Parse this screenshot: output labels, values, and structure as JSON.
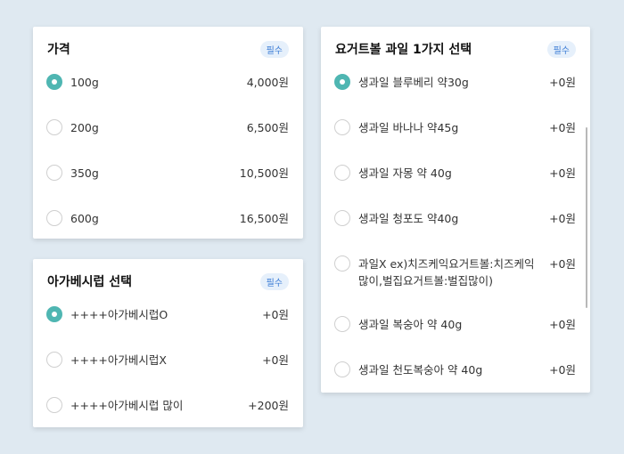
{
  "price_card": {
    "title": "가격",
    "badge": "필수",
    "options": [
      {
        "label": "100g",
        "price": "4,000원",
        "selected": true
      },
      {
        "label": "200g",
        "price": "6,500원",
        "selected": false
      },
      {
        "label": "350g",
        "price": "10,500원",
        "selected": false
      },
      {
        "label": "600g",
        "price": "16,500원",
        "selected": false
      }
    ]
  },
  "syrup_card": {
    "title": "아가베시럽 선택",
    "badge": "필수",
    "options": [
      {
        "label": "++++아가베시럽O",
        "price": "+0원",
        "selected": true
      },
      {
        "label": "++++아가베시럽X",
        "price": "+0원",
        "selected": false
      },
      {
        "label": "++++아가베시럽 많이",
        "price": "+200원",
        "selected": false
      }
    ]
  },
  "fruit_card": {
    "title": "요거트볼 과일 1가지 선택",
    "badge": "필수",
    "options": [
      {
        "label": "생과일 블루베리 약30g",
        "price": "+0원",
        "selected": true
      },
      {
        "label": "생과일 바나나 약45g",
        "price": "+0원",
        "selected": false
      },
      {
        "label": "생과일 자몽 약 40g",
        "price": "+0원",
        "selected": false
      },
      {
        "label": "생과일 청포도 약40g",
        "price": "+0원",
        "selected": false
      },
      {
        "label": "과일X ex)치즈케익요거트볼:치즈케익많이,벌집요거트볼:벌집많이)",
        "price": "+0원",
        "selected": false
      },
      {
        "label": "생과일 복숭아 약 40g",
        "price": "+0원",
        "selected": false
      },
      {
        "label": "생과일 천도복숭아 약 40g",
        "price": "+0원",
        "selected": false
      }
    ]
  },
  "colors": {
    "accent": "#4fb6b2",
    "badge_text": "#3a7bd5",
    "background": "#dfe9f1"
  }
}
